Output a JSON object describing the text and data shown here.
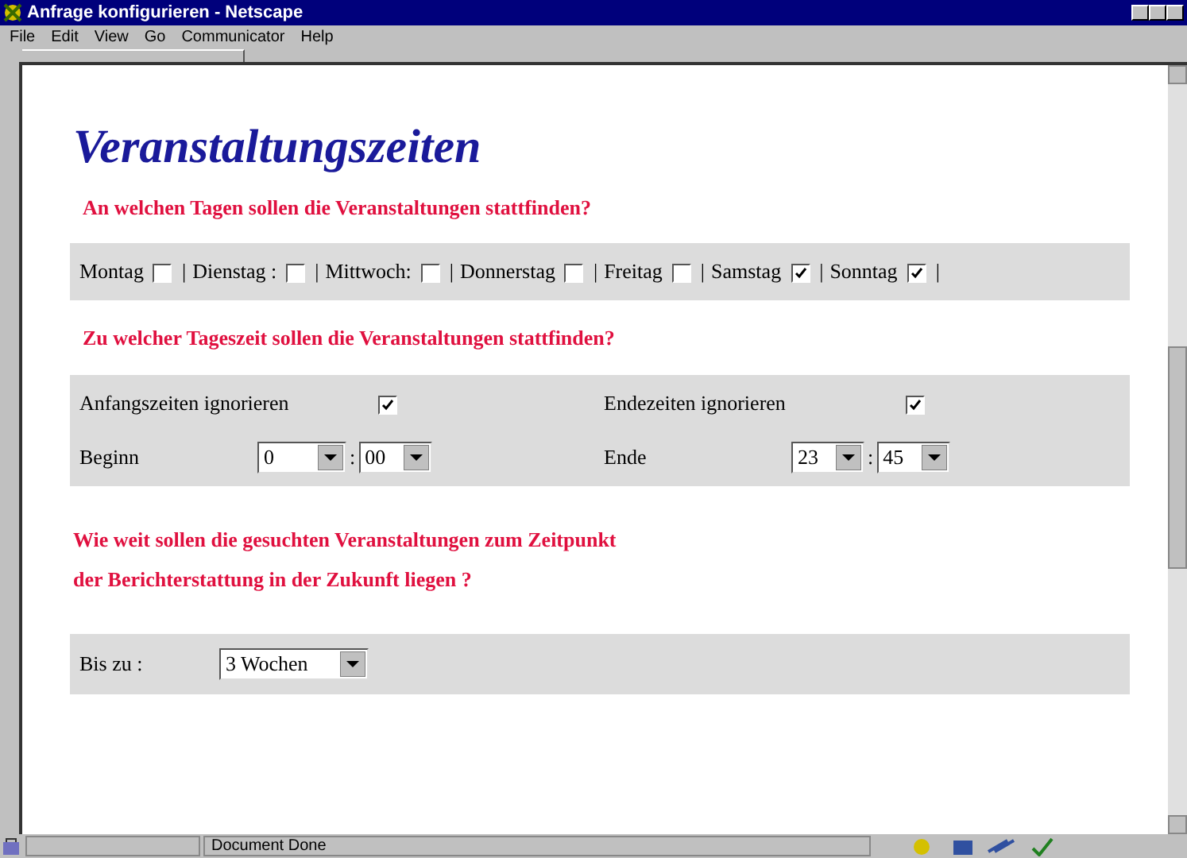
{
  "window": {
    "title": "Anfrage konfigurieren - Netscape"
  },
  "menu": [
    "File",
    "Edit",
    "View",
    "Go",
    "Communicator",
    "Help"
  ],
  "heading": "Veranstaltungszeiten",
  "days_question": "An welchen Tagen sollen die Veranstaltungen stattfinden?",
  "days": [
    {
      "label": "Montag",
      "checked": false
    },
    {
      "label": "Dienstag :",
      "checked": false
    },
    {
      "label": "Mittwoch:",
      "checked": false
    },
    {
      "label": "Donnerstag",
      "checked": false
    },
    {
      "label": "Freitag",
      "checked": false
    },
    {
      "label": "Samstag",
      "checked": true
    },
    {
      "label": "Sonntag",
      "checked": true
    }
  ],
  "separator": "|",
  "time_question": "Zu welcher Tageszeit sollen die Veranstaltungen stattfinden?",
  "ignore_start": {
    "label": "Anfangszeiten ignorieren",
    "checked": true
  },
  "ignore_end": {
    "label": "Endezeiten ignorieren",
    "checked": true
  },
  "begin": {
    "label": "Beginn",
    "hour": "0",
    "minute": "00",
    "colon": ":"
  },
  "end": {
    "label": "Ende",
    "hour": "23",
    "minute": "45",
    "colon": ":"
  },
  "future_question": [
    "Wie weit sollen die gesuchten Veranstaltungen zum Zeitpunkt",
    "der Berichterstattung in der Zukunft liegen ?"
  ],
  "until": {
    "label": "Bis zu :",
    "value": "3 Wochen"
  },
  "status_bar": {
    "text": "Document Done"
  }
}
